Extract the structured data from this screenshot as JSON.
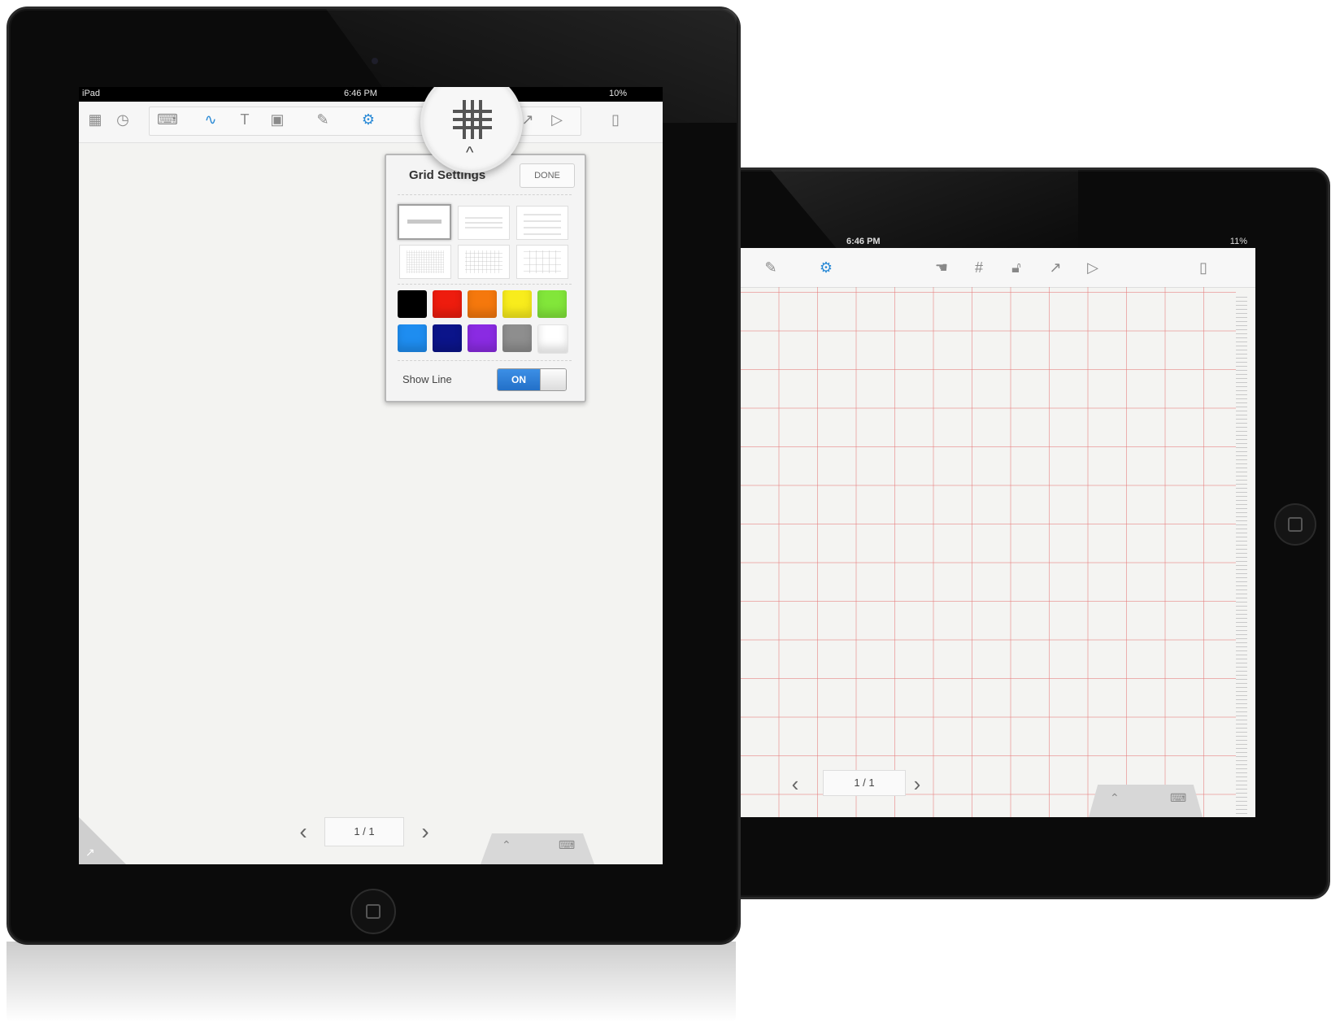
{
  "portrait_ipad": {
    "status_bar": {
      "carrier": "iPad",
      "time": "6:46 PM",
      "battery": "10%"
    },
    "toolbar": {
      "icons": [
        "apps-grid-icon",
        "clock-icon",
        "keyboard-icon",
        "pen-icon",
        "text-icon",
        "image-icon",
        "note-icon",
        "settings-gear-icon",
        "share-icon",
        "play-icon",
        "bookmark-icon"
      ]
    },
    "grid_settings": {
      "title": "Grid Settings",
      "done_label": "DONE",
      "line_styles": [
        "single-line",
        "double-line",
        "triple-line",
        "fine-grid",
        "medium-grid",
        "large-grid"
      ],
      "selected_style": "single-line",
      "colors": [
        "#000000",
        "#ee1c0e",
        "#f5780d",
        "#f8ec1c",
        "#82e63a",
        "#1e8df0",
        "#0b148a",
        "#8a2be2",
        "#8e8e8e",
        "#ffffff"
      ],
      "show_line_label": "Show Line",
      "show_line_state": "ON"
    },
    "pager": {
      "prev": "‹",
      "page": "1 / 1",
      "next": "›"
    }
  },
  "landscape_ipad": {
    "status_bar": {
      "time": "6:46 PM",
      "battery": "11%"
    },
    "toolbar": {
      "icons": [
        "note-icon",
        "settings-gear-icon",
        "hand-icon",
        "grid-icon",
        "lock-icon",
        "share-icon",
        "play-icon",
        "bookmark-icon"
      ]
    },
    "grid_color": "#e67878",
    "pager": {
      "prev": "‹",
      "page": "1 / 1",
      "next": "›"
    }
  }
}
